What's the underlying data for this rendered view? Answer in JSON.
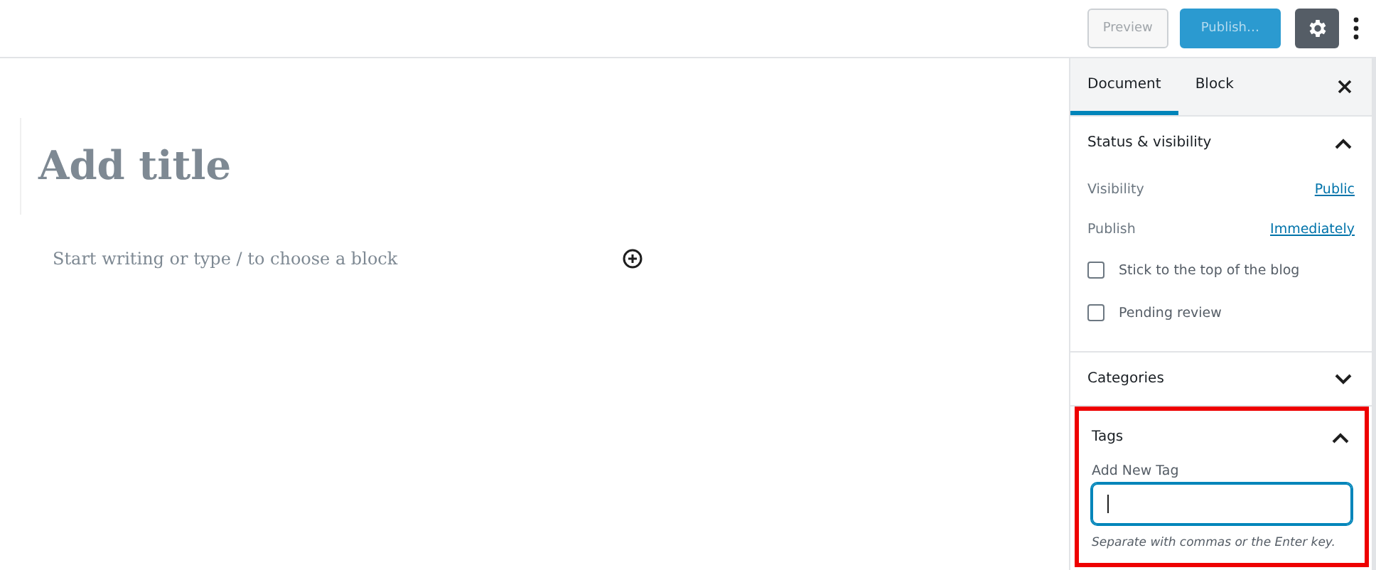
{
  "toolbar": {
    "buttons": [
      {
        "label": "Preview",
        "kind": "secondary",
        "disabled": true
      },
      {
        "label": "Publish…",
        "kind": "primary",
        "disabled": true
      }
    ],
    "settings": {
      "on": true
    }
  },
  "editor": {
    "title_placeholder": "Add title",
    "block_placeholder": "Start writing or type / to choose a block"
  },
  "sidebar": {
    "tabs": [
      {
        "label": "Document",
        "selected": true
      },
      {
        "label": "Block",
        "selected": false
      }
    ],
    "panels": [
      {
        "title": "Status & visibility",
        "expanded": true,
        "highlighted": false,
        "kind": "status",
        "rows": [
          {
            "label": "Visibility",
            "value": "Public"
          },
          {
            "label": "Publish",
            "value": "Immediately"
          }
        ],
        "checkboxes": [
          {
            "label": "Stick to the top of the blog",
            "checked": false
          },
          {
            "label": "Pending review",
            "checked": false
          }
        ]
      },
      {
        "title": "Categories",
        "expanded": false,
        "highlighted": false
      },
      {
        "title": "Tags",
        "expanded": true,
        "highlighted": true,
        "kind": "tags",
        "field_label": "Add New Tag",
        "focused": true,
        "help": "Separate with commas or the Enter key."
      }
    ]
  }
}
